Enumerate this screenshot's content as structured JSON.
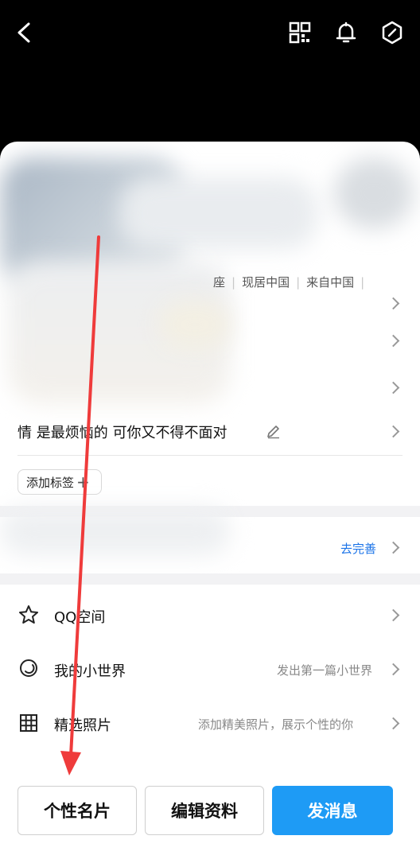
{
  "profile": {
    "info_items": [
      "座",
      "现居中国",
      "来自中国"
    ],
    "signature": "情 是最烦恼的 可你又不得不面对"
  },
  "tags": {
    "add_label": "添加标签",
    "plus_glyph": "+"
  },
  "complete_section": {
    "action": "去完善"
  },
  "menu": [
    {
      "label": "QQ空间",
      "icon": "star-icon",
      "hint": ""
    },
    {
      "label": "我的小世界",
      "icon": "moon-icon",
      "hint": "发出第一篇小世界"
    },
    {
      "label": "精选照片",
      "icon": "grid-icon",
      "hint": "添加精美照片，展示个性的你"
    }
  ],
  "buttons": {
    "card": "个性名片",
    "edit": "编辑资料",
    "message": "发消息"
  },
  "colors": {
    "accent": "#1e9bf5",
    "link": "#1a73e8",
    "annotation_arrow": "#ef3b3b"
  }
}
